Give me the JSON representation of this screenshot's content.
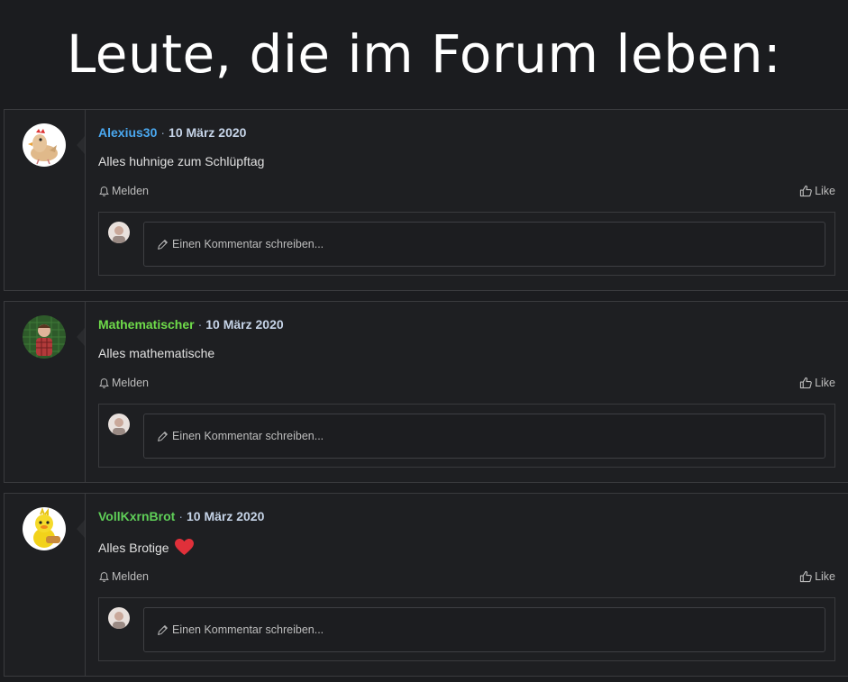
{
  "headline": "Leute, die im Forum leben:",
  "posts": [
    {
      "author": "Alexius30",
      "author_color": "#4aa8f0",
      "separator": "·",
      "date": "10 März 2020",
      "text": "Alles huhnige zum Schlüpftag",
      "heart": false,
      "avatar_icon": "chicken-avatar-icon",
      "report_label": "Melden",
      "like_label": "Like",
      "comment_placeholder": "Einen Kommentar schreiben..."
    },
    {
      "author": "Mathematischer",
      "author_color": "#6fdc4a",
      "separator": "·",
      "date": "10 März 2020",
      "text": "Alles mathematische",
      "heart": false,
      "avatar_icon": "person-avatar-icon",
      "report_label": "Melden",
      "like_label": "Like",
      "comment_placeholder": "Einen Kommentar schreiben..."
    },
    {
      "author": "VollKxrnBrot",
      "author_color": "#5fcf58",
      "separator": "·",
      "date": "10 März 2020",
      "text": "Alles Brotige",
      "heart": true,
      "avatar_icon": "duck-avatar-icon",
      "report_label": "Melden",
      "like_label": "Like",
      "comment_placeholder": "Einen Kommentar schreiben..."
    }
  ],
  "colors": {
    "background": "#1b1c1f",
    "panel": "#1e1f22",
    "border": "#3a3b3e",
    "date": "#c6d4e8",
    "heart": "#e0303a"
  }
}
